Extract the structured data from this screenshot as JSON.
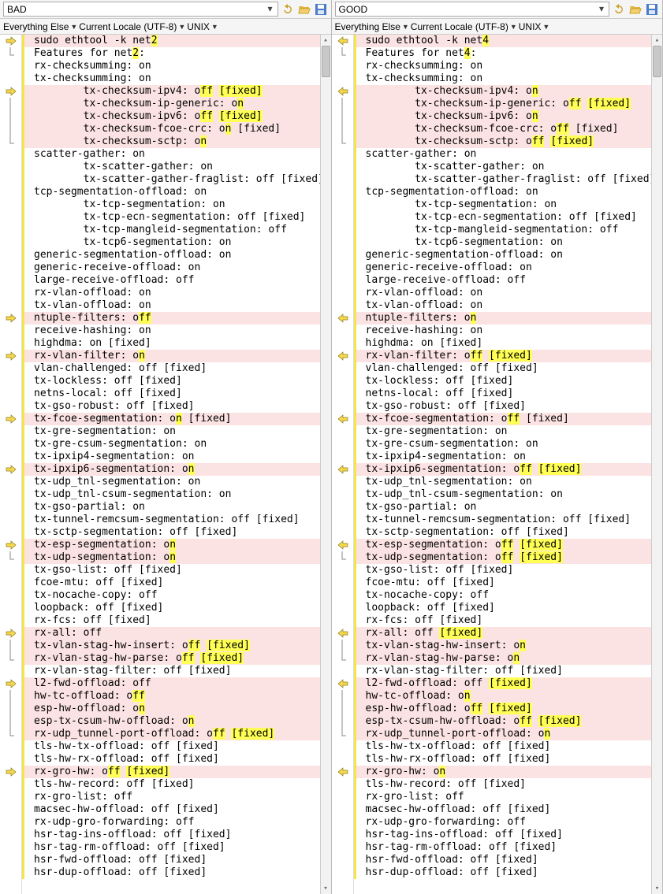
{
  "panes": [
    {
      "title": "BAD",
      "filters": [
        "Everything Else",
        "Current Locale (UTF-8)",
        "UNIX"
      ]
    },
    {
      "title": "GOOD",
      "filters": [
        "Everything Else",
        "Current Locale (UTF-8)",
        "UNIX"
      ]
    }
  ],
  "icons": {
    "undo": "undo-icon",
    "open": "folder-open-icon",
    "save": "save-icon"
  },
  "lines_left": [
    {
      "mark": "r",
      "diff": true,
      "seg": [
        {
          "t": "sudo ethtool -k net"
        },
        {
          "t": "2",
          "h": 1
        }
      ]
    },
    {
      "mark": "e",
      "seg": [
        {
          "t": "Features for net"
        },
        {
          "t": "2",
          "h": 1
        },
        {
          "t": ":"
        }
      ]
    },
    {
      "seg": [
        {
          "t": "rx-checksumming: on"
        }
      ]
    },
    {
      "seg": [
        {
          "t": "tx-checksumming: on"
        }
      ]
    },
    {
      "mark": "r",
      "diff": true,
      "seg": [
        {
          "t": "        tx-checksum-ipv4: o"
        },
        {
          "t": "ff",
          "h": 1
        },
        {
          "t": " "
        },
        {
          "t": "[fixed]",
          "h": 1
        }
      ]
    },
    {
      "mark": "|",
      "diff": true,
      "seg": [
        {
          "t": "        tx-checksum-ip-generic: o"
        },
        {
          "t": "n",
          "h": 1
        }
      ]
    },
    {
      "mark": "|",
      "diff": true,
      "seg": [
        {
          "t": "        tx-checksum-ipv6: o"
        },
        {
          "t": "ff",
          "h": 1
        },
        {
          "t": " "
        },
        {
          "t": "[fixed]",
          "h": 1
        }
      ]
    },
    {
      "mark": "|",
      "diff": true,
      "seg": [
        {
          "t": "        tx-checksum-fcoe-crc: o"
        },
        {
          "t": "n",
          "h": 1
        },
        {
          "t": " [fixed]"
        }
      ]
    },
    {
      "mark": "e",
      "diff": true,
      "seg": [
        {
          "t": "        tx-checksum-sctp: o"
        },
        {
          "t": "n",
          "h": 1
        }
      ]
    },
    {
      "seg": [
        {
          "t": "scatter-gather: on"
        }
      ]
    },
    {
      "seg": [
        {
          "t": "        tx-scatter-gather: on"
        }
      ]
    },
    {
      "seg": [
        {
          "t": "        tx-scatter-gather-fraglist: off [fixed]"
        }
      ]
    },
    {
      "seg": [
        {
          "t": "tcp-segmentation-offload: on"
        }
      ]
    },
    {
      "seg": [
        {
          "t": "        tx-tcp-segmentation: on"
        }
      ]
    },
    {
      "seg": [
        {
          "t": "        tx-tcp-ecn-segmentation: off [fixed]"
        }
      ]
    },
    {
      "seg": [
        {
          "t": "        tx-tcp-mangleid-segmentation: off"
        }
      ]
    },
    {
      "seg": [
        {
          "t": "        tx-tcp6-segmentation: on"
        }
      ]
    },
    {
      "seg": [
        {
          "t": "generic-segmentation-offload: on"
        }
      ]
    },
    {
      "seg": [
        {
          "t": "generic-receive-offload: on"
        }
      ]
    },
    {
      "seg": [
        {
          "t": "large-receive-offload: off"
        }
      ]
    },
    {
      "seg": [
        {
          "t": "rx-vlan-offload: on"
        }
      ]
    },
    {
      "seg": [
        {
          "t": "tx-vlan-offload: on"
        }
      ]
    },
    {
      "mark": "r",
      "diff": true,
      "seg": [
        {
          "t": "ntuple-filters: o"
        },
        {
          "t": "ff",
          "h": 1
        }
      ]
    },
    {
      "seg": [
        {
          "t": "receive-hashing: on"
        }
      ]
    },
    {
      "seg": [
        {
          "t": "highdma: on [fixed]"
        }
      ]
    },
    {
      "mark": "r",
      "diff": true,
      "seg": [
        {
          "t": "rx-vlan-filter: o"
        },
        {
          "t": "n",
          "h": 1
        }
      ]
    },
    {
      "seg": [
        {
          "t": "vlan-challenged: off [fixed]"
        }
      ]
    },
    {
      "seg": [
        {
          "t": "tx-lockless: off [fixed]"
        }
      ]
    },
    {
      "seg": [
        {
          "t": "netns-local: off [fixed]"
        }
      ]
    },
    {
      "seg": [
        {
          "t": "tx-gso-robust: off [fixed]"
        }
      ]
    },
    {
      "mark": "r",
      "diff": true,
      "seg": [
        {
          "t": "tx-fcoe-segmentation: o"
        },
        {
          "t": "n",
          "h": 1
        },
        {
          "t": " [fixed]"
        }
      ]
    },
    {
      "seg": [
        {
          "t": "tx-gre-segmentation: on"
        }
      ]
    },
    {
      "seg": [
        {
          "t": "tx-gre-csum-segmentation: on"
        }
      ]
    },
    {
      "seg": [
        {
          "t": "tx-ipxip4-segmentation: on"
        }
      ]
    },
    {
      "mark": "r",
      "diff": true,
      "seg": [
        {
          "t": "tx-ipxip6-segmentation: o"
        },
        {
          "t": "n",
          "h": 1
        }
      ]
    },
    {
      "seg": [
        {
          "t": "tx-udp_tnl-segmentation: on"
        }
      ]
    },
    {
      "seg": [
        {
          "t": "tx-udp_tnl-csum-segmentation: on"
        }
      ]
    },
    {
      "seg": [
        {
          "t": "tx-gso-partial: on"
        }
      ]
    },
    {
      "seg": [
        {
          "t": "tx-tunnel-remcsum-segmentation: off [fixed]"
        }
      ]
    },
    {
      "seg": [
        {
          "t": "tx-sctp-segmentation: off [fixed]"
        }
      ]
    },
    {
      "mark": "r",
      "diff": true,
      "seg": [
        {
          "t": "tx-esp-segmentation: o"
        },
        {
          "t": "n",
          "h": 1
        }
      ]
    },
    {
      "mark": "e",
      "diff": true,
      "seg": [
        {
          "t": "tx-udp-segmentation: o"
        },
        {
          "t": "n",
          "h": 1
        }
      ]
    },
    {
      "seg": [
        {
          "t": "tx-gso-list: off [fixed]"
        }
      ]
    },
    {
      "seg": [
        {
          "t": "fcoe-mtu: off [fixed]"
        }
      ]
    },
    {
      "seg": [
        {
          "t": "tx-nocache-copy: off"
        }
      ]
    },
    {
      "seg": [
        {
          "t": "loopback: off [fixed]"
        }
      ]
    },
    {
      "seg": [
        {
          "t": "rx-fcs: off [fixed]"
        }
      ]
    },
    {
      "mark": "r",
      "diff": true,
      "seg": [
        {
          "t": "rx-all: off"
        }
      ]
    },
    {
      "mark": "|",
      "diff": true,
      "seg": [
        {
          "t": "tx-vlan-stag-hw-insert: o"
        },
        {
          "t": "ff",
          "h": 1
        },
        {
          "t": " "
        },
        {
          "t": "[fixed]",
          "h": 1
        }
      ]
    },
    {
      "mark": "e",
      "diff": true,
      "seg": [
        {
          "t": "rx-vlan-stag-hw-parse: o"
        },
        {
          "t": "ff",
          "h": 1
        },
        {
          "t": " "
        },
        {
          "t": "[fixed]",
          "h": 1
        }
      ]
    },
    {
      "seg": [
        {
          "t": "rx-vlan-stag-filter: off [fixed]"
        }
      ]
    },
    {
      "mark": "r",
      "diff": true,
      "seg": [
        {
          "t": "l2-fwd-offload: off"
        }
      ]
    },
    {
      "mark": "|",
      "diff": true,
      "seg": [
        {
          "t": "hw-tc-offload: o"
        },
        {
          "t": "ff",
          "h": 1
        }
      ]
    },
    {
      "mark": "|",
      "diff": true,
      "seg": [
        {
          "t": "esp-hw-offload: o"
        },
        {
          "t": "n",
          "h": 1
        }
      ]
    },
    {
      "mark": "|",
      "diff": true,
      "seg": [
        {
          "t": "esp-tx-csum-hw-offload: o"
        },
        {
          "t": "n",
          "h": 1
        }
      ]
    },
    {
      "mark": "e",
      "diff": true,
      "seg": [
        {
          "t": "rx-udp_tunnel-port-offload: o"
        },
        {
          "t": "ff",
          "h": 1
        },
        {
          "t": " "
        },
        {
          "t": "[fixed]",
          "h": 1
        }
      ]
    },
    {
      "seg": [
        {
          "t": "tls-hw-tx-offload: off [fixed]"
        }
      ]
    },
    {
      "seg": [
        {
          "t": "tls-hw-rx-offload: off [fixed]"
        }
      ]
    },
    {
      "mark": "r",
      "diff": true,
      "seg": [
        {
          "t": "rx-gro-hw: o"
        },
        {
          "t": "ff",
          "h": 1
        },
        {
          "t": " "
        },
        {
          "t": "[fixed]",
          "h": 1
        }
      ]
    },
    {
      "seg": [
        {
          "t": "tls-hw-record: off [fixed]"
        }
      ]
    },
    {
      "seg": [
        {
          "t": "rx-gro-list: off"
        }
      ]
    },
    {
      "seg": [
        {
          "t": "macsec-hw-offload: off [fixed]"
        }
      ]
    },
    {
      "seg": [
        {
          "t": "rx-udp-gro-forwarding: off"
        }
      ]
    },
    {
      "seg": [
        {
          "t": "hsr-tag-ins-offload: off [fixed]"
        }
      ]
    },
    {
      "seg": [
        {
          "t": "hsr-tag-rm-offload: off [fixed]"
        }
      ]
    },
    {
      "seg": [
        {
          "t": "hsr-fwd-offload: off [fixed]"
        }
      ]
    },
    {
      "seg": [
        {
          "t": "hsr-dup-offload: off [fixed]"
        }
      ]
    }
  ],
  "lines_right": [
    {
      "mark": "l",
      "diff": true,
      "seg": [
        {
          "t": "sudo ethtool -k net"
        },
        {
          "t": "4",
          "h": 1
        }
      ]
    },
    {
      "mark": "e",
      "seg": [
        {
          "t": "Features for net"
        },
        {
          "t": "4",
          "h": 1
        },
        {
          "t": ":"
        }
      ]
    },
    {
      "seg": [
        {
          "t": "rx-checksumming: on"
        }
      ]
    },
    {
      "seg": [
        {
          "t": "tx-checksumming: on"
        }
      ]
    },
    {
      "mark": "l",
      "diff": true,
      "seg": [
        {
          "t": "        tx-checksum-ipv4: o"
        },
        {
          "t": "n",
          "h": 1
        }
      ]
    },
    {
      "mark": "|",
      "diff": true,
      "seg": [
        {
          "t": "        tx-checksum-ip-generic: o"
        },
        {
          "t": "ff",
          "h": 1
        },
        {
          "t": " "
        },
        {
          "t": "[fixed]",
          "h": 1
        }
      ]
    },
    {
      "mark": "|",
      "diff": true,
      "seg": [
        {
          "t": "        tx-checksum-ipv6: o"
        },
        {
          "t": "n",
          "h": 1
        }
      ]
    },
    {
      "mark": "|",
      "diff": true,
      "seg": [
        {
          "t": "        tx-checksum-fcoe-crc: o"
        },
        {
          "t": "ff",
          "h": 1
        },
        {
          "t": " [fixed]"
        }
      ]
    },
    {
      "mark": "e",
      "diff": true,
      "seg": [
        {
          "t": "        tx-checksum-sctp: o"
        },
        {
          "t": "ff",
          "h": 1
        },
        {
          "t": " "
        },
        {
          "t": "[fixed]",
          "h": 1
        }
      ]
    },
    {
      "seg": [
        {
          "t": "scatter-gather: on"
        }
      ]
    },
    {
      "seg": [
        {
          "t": "        tx-scatter-gather: on"
        }
      ]
    },
    {
      "seg": [
        {
          "t": "        tx-scatter-gather-fraglist: off [fixed]"
        }
      ]
    },
    {
      "seg": [
        {
          "t": "tcp-segmentation-offload: on"
        }
      ]
    },
    {
      "seg": [
        {
          "t": "        tx-tcp-segmentation: on"
        }
      ]
    },
    {
      "seg": [
        {
          "t": "        tx-tcp-ecn-segmentation: off [fixed]"
        }
      ]
    },
    {
      "seg": [
        {
          "t": "        tx-tcp-mangleid-segmentation: off"
        }
      ]
    },
    {
      "seg": [
        {
          "t": "        tx-tcp6-segmentation: on"
        }
      ]
    },
    {
      "seg": [
        {
          "t": "generic-segmentation-offload: on"
        }
      ]
    },
    {
      "seg": [
        {
          "t": "generic-receive-offload: on"
        }
      ]
    },
    {
      "seg": [
        {
          "t": "large-receive-offload: off"
        }
      ]
    },
    {
      "seg": [
        {
          "t": "rx-vlan-offload: on"
        }
      ]
    },
    {
      "seg": [
        {
          "t": "tx-vlan-offload: on"
        }
      ]
    },
    {
      "mark": "l",
      "diff": true,
      "seg": [
        {
          "t": "ntuple-filters: o"
        },
        {
          "t": "n",
          "h": 1
        }
      ]
    },
    {
      "seg": [
        {
          "t": "receive-hashing: on"
        }
      ]
    },
    {
      "seg": [
        {
          "t": "highdma: on [fixed]"
        }
      ]
    },
    {
      "mark": "l",
      "diff": true,
      "seg": [
        {
          "t": "rx-vlan-filter: o"
        },
        {
          "t": "ff",
          "h": 1
        },
        {
          "t": " "
        },
        {
          "t": "[fixed]",
          "h": 1
        }
      ]
    },
    {
      "seg": [
        {
          "t": "vlan-challenged: off [fixed]"
        }
      ]
    },
    {
      "seg": [
        {
          "t": "tx-lockless: off [fixed]"
        }
      ]
    },
    {
      "seg": [
        {
          "t": "netns-local: off [fixed]"
        }
      ]
    },
    {
      "seg": [
        {
          "t": "tx-gso-robust: off [fixed]"
        }
      ]
    },
    {
      "mark": "l",
      "diff": true,
      "seg": [
        {
          "t": "tx-fcoe-segmentation: o"
        },
        {
          "t": "ff",
          "h": 1
        },
        {
          "t": " [fixed]"
        }
      ]
    },
    {
      "seg": [
        {
          "t": "tx-gre-segmentation: on"
        }
      ]
    },
    {
      "seg": [
        {
          "t": "tx-gre-csum-segmentation: on"
        }
      ]
    },
    {
      "seg": [
        {
          "t": "tx-ipxip4-segmentation: on"
        }
      ]
    },
    {
      "mark": "l",
      "diff": true,
      "seg": [
        {
          "t": "tx-ipxip6-segmentation: o"
        },
        {
          "t": "ff",
          "h": 1
        },
        {
          "t": " "
        },
        {
          "t": "[fixed]",
          "h": 1
        }
      ]
    },
    {
      "seg": [
        {
          "t": "tx-udp_tnl-segmentation: on"
        }
      ]
    },
    {
      "seg": [
        {
          "t": "tx-udp_tnl-csum-segmentation: on"
        }
      ]
    },
    {
      "seg": [
        {
          "t": "tx-gso-partial: on"
        }
      ]
    },
    {
      "seg": [
        {
          "t": "tx-tunnel-remcsum-segmentation: off [fixed]"
        }
      ]
    },
    {
      "seg": [
        {
          "t": "tx-sctp-segmentation: off [fixed]"
        }
      ]
    },
    {
      "mark": "l",
      "diff": true,
      "seg": [
        {
          "t": "tx-esp-segmentation: o"
        },
        {
          "t": "ff",
          "h": 1
        },
        {
          "t": " "
        },
        {
          "t": "[fixed]",
          "h": 1
        }
      ]
    },
    {
      "mark": "e",
      "diff": true,
      "seg": [
        {
          "t": "tx-udp-segmentation: o"
        },
        {
          "t": "ff",
          "h": 1
        },
        {
          "t": " "
        },
        {
          "t": "[fixed]",
          "h": 1
        }
      ]
    },
    {
      "seg": [
        {
          "t": "tx-gso-list: off [fixed]"
        }
      ]
    },
    {
      "seg": [
        {
          "t": "fcoe-mtu: off [fixed]"
        }
      ]
    },
    {
      "seg": [
        {
          "t": "tx-nocache-copy: off"
        }
      ]
    },
    {
      "seg": [
        {
          "t": "loopback: off [fixed]"
        }
      ]
    },
    {
      "seg": [
        {
          "t": "rx-fcs: off [fixed]"
        }
      ]
    },
    {
      "mark": "l",
      "diff": true,
      "seg": [
        {
          "t": "rx-all: off "
        },
        {
          "t": "[fixed]",
          "h": 1
        }
      ]
    },
    {
      "mark": "|",
      "diff": true,
      "seg": [
        {
          "t": "tx-vlan-stag-hw-insert: o"
        },
        {
          "t": "n",
          "h": 1
        }
      ]
    },
    {
      "mark": "e",
      "diff": true,
      "seg": [
        {
          "t": "rx-vlan-stag-hw-parse: o"
        },
        {
          "t": "n",
          "h": 1
        }
      ]
    },
    {
      "seg": [
        {
          "t": "rx-vlan-stag-filter: off [fixed]"
        }
      ]
    },
    {
      "mark": "l",
      "diff": true,
      "seg": [
        {
          "t": "l2-fwd-offload: off "
        },
        {
          "t": "[fixed]",
          "h": 1
        }
      ]
    },
    {
      "mark": "|",
      "diff": true,
      "seg": [
        {
          "t": "hw-tc-offload: o"
        },
        {
          "t": "n",
          "h": 1
        }
      ]
    },
    {
      "mark": "|",
      "diff": true,
      "seg": [
        {
          "t": "esp-hw-offload: o"
        },
        {
          "t": "ff",
          "h": 1
        },
        {
          "t": " "
        },
        {
          "t": "[fixed]",
          "h": 1
        }
      ]
    },
    {
      "mark": "|",
      "diff": true,
      "seg": [
        {
          "t": "esp-tx-csum-hw-offload: o"
        },
        {
          "t": "ff",
          "h": 1
        },
        {
          "t": " "
        },
        {
          "t": "[fixed]",
          "h": 1
        }
      ]
    },
    {
      "mark": "e",
      "diff": true,
      "seg": [
        {
          "t": "rx-udp_tunnel-port-offload: o"
        },
        {
          "t": "n",
          "h": 1
        }
      ]
    },
    {
      "seg": [
        {
          "t": "tls-hw-tx-offload: off [fixed]"
        }
      ]
    },
    {
      "seg": [
        {
          "t": "tls-hw-rx-offload: off [fixed]"
        }
      ]
    },
    {
      "mark": "l",
      "diff": true,
      "seg": [
        {
          "t": "rx-gro-hw: o"
        },
        {
          "t": "n",
          "h": 1
        }
      ]
    },
    {
      "seg": [
        {
          "t": "tls-hw-record: off [fixed]"
        }
      ]
    },
    {
      "seg": [
        {
          "t": "rx-gro-list: off"
        }
      ]
    },
    {
      "seg": [
        {
          "t": "macsec-hw-offload: off [fixed]"
        }
      ]
    },
    {
      "seg": [
        {
          "t": "rx-udp-gro-forwarding: off"
        }
      ]
    },
    {
      "seg": [
        {
          "t": "hsr-tag-ins-offload: off [fixed]"
        }
      ]
    },
    {
      "seg": [
        {
          "t": "hsr-tag-rm-offload: off [fixed]"
        }
      ]
    },
    {
      "seg": [
        {
          "t": "hsr-fwd-offload: off [fixed]"
        }
      ]
    },
    {
      "seg": [
        {
          "t": "hsr-dup-offload: off [fixed]"
        }
      ]
    }
  ]
}
